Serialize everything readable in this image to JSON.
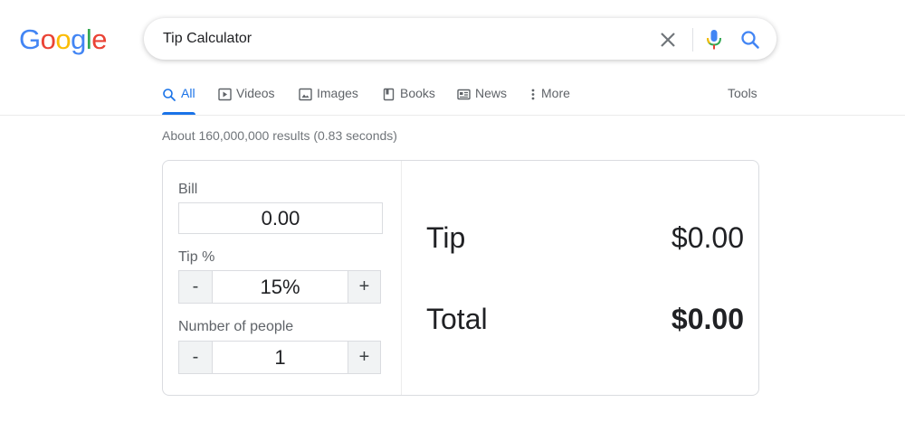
{
  "logo": {
    "letters": [
      "G",
      "o",
      "o",
      "g",
      "l",
      "e"
    ],
    "colors": [
      "#4285f4",
      "#ea4335",
      "#fbbc05",
      "#4285f4",
      "#34a853",
      "#ea4335"
    ]
  },
  "search": {
    "query": "Tip Calculator",
    "accent_blue": "#4285f4"
  },
  "tabs": [
    {
      "label": "All",
      "icon": "search-icon",
      "active": true
    },
    {
      "label": "Videos",
      "icon": "play-icon"
    },
    {
      "label": "Images",
      "icon": "image-icon"
    },
    {
      "label": "Books",
      "icon": "book-icon"
    },
    {
      "label": "News",
      "icon": "news-icon"
    },
    {
      "label": "More",
      "icon": "more-vert-icon"
    }
  ],
  "tools_label": "Tools",
  "result_stats": "About 160,000,000 results (0.83 seconds)",
  "calculator": {
    "bill_label": "Bill",
    "bill_value": "0.00",
    "tip_label": "Tip %",
    "tip_value": "15%",
    "people_label": "Number of people",
    "people_value": "1",
    "minus": "-",
    "plus": "+",
    "tip_out_label": "Tip",
    "tip_out_value": "$0.00",
    "total_out_label": "Total",
    "total_out_value": "$0.00"
  }
}
